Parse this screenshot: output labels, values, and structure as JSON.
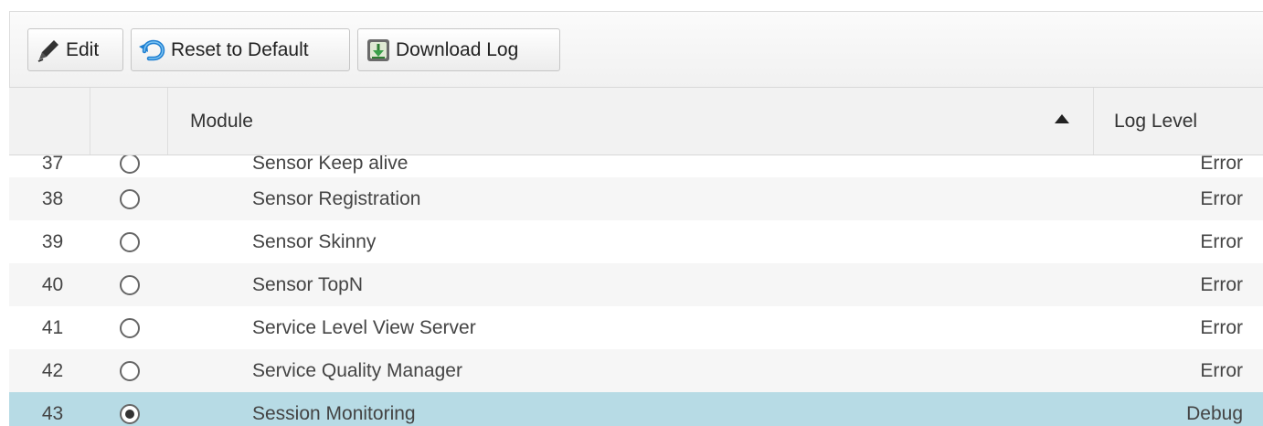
{
  "toolbar": {
    "edit_label": "Edit",
    "reset_label": "Reset to Default",
    "download_label": "Download Log"
  },
  "table": {
    "columns": {
      "number": "",
      "select": "",
      "module": "Module",
      "log_level": "Log Level"
    },
    "sort": {
      "column": "module",
      "direction": "ascending"
    },
    "rows": [
      {
        "num": "37",
        "module": "Sensor Keep alive",
        "level": "Error",
        "selected": false
      },
      {
        "num": "38",
        "module": "Sensor Registration",
        "level": "Error",
        "selected": false
      },
      {
        "num": "39",
        "module": "Sensor Skinny",
        "level": "Error",
        "selected": false
      },
      {
        "num": "40",
        "module": "Sensor TopN",
        "level": "Error",
        "selected": false
      },
      {
        "num": "41",
        "module": "Service Level View Server",
        "level": "Error",
        "selected": false
      },
      {
        "num": "42",
        "module": "Service Quality Manager",
        "level": "Error",
        "selected": false
      },
      {
        "num": "43",
        "module": "Session Monitoring",
        "level": "Debug",
        "selected": true
      }
    ]
  },
  "colors": {
    "selected_row": "#b7dbe5",
    "header_bg": "#f2f2f2",
    "toolbar_bg": "#f4f4f4"
  },
  "icons": {
    "edit": "pencil-icon",
    "reset": "undo-arrow-icon",
    "download": "download-log-icon",
    "sort": "sort-ascending-icon"
  }
}
